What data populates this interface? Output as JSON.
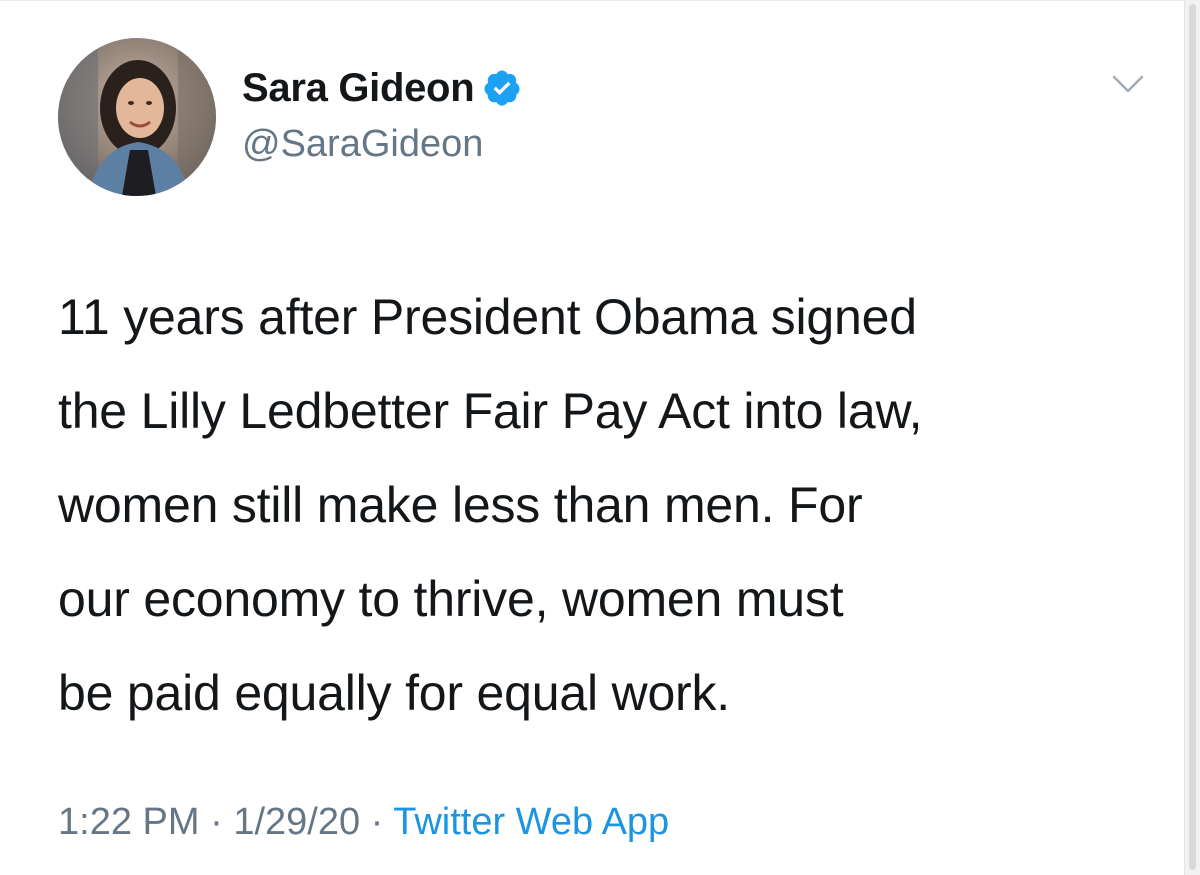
{
  "author": {
    "display_name": "Sara Gideon",
    "handle": "@SaraGideon",
    "verified": true
  },
  "tweet": {
    "lines": [
      "11 years after President Obama signed",
      "the Lilly Ledbetter Fair Pay Act into law,",
      "women still make less than men. For",
      "our economy to thrive, women must",
      "be paid equally for equal work."
    ],
    "time": "1:22 PM",
    "separator": "·",
    "date": "1/29/20",
    "source": "Twitter Web App"
  },
  "icons": {
    "verified": "verified-badge-icon",
    "menu": "chevron-down-icon"
  },
  "colors": {
    "text": "#14171a",
    "secondary": "#657786",
    "link": "#1b95e0",
    "verified": "#1da1f2"
  }
}
